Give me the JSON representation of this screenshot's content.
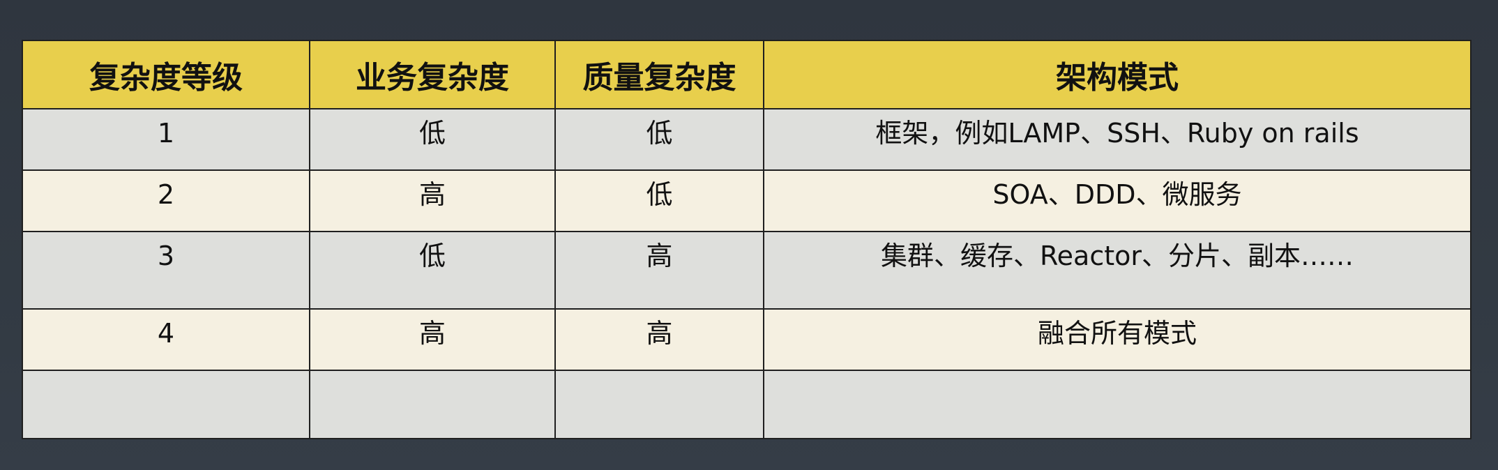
{
  "table": {
    "headers": [
      "复杂度等级",
      "业务复杂度",
      "质量复杂度",
      "架构模式"
    ],
    "rows": [
      [
        "1",
        "低",
        "低",
        "框架，例如LAMP、SSH、Ruby on rails"
      ],
      [
        "2",
        "高",
        "低",
        "SOA、DDD、微服务"
      ],
      [
        "3",
        "低",
        "高",
        "集群、缓存、Reactor、分片、副本……"
      ],
      [
        "4",
        "高",
        "高",
        "融合所有模式"
      ],
      [
        "",
        "",
        "",
        ""
      ]
    ]
  },
  "colors": {
    "header_bg": "#e8cf4c",
    "row_odd_bg": "#dedfdc",
    "row_even_bg": "#f5f0e1",
    "page_bg": "#323a43"
  }
}
